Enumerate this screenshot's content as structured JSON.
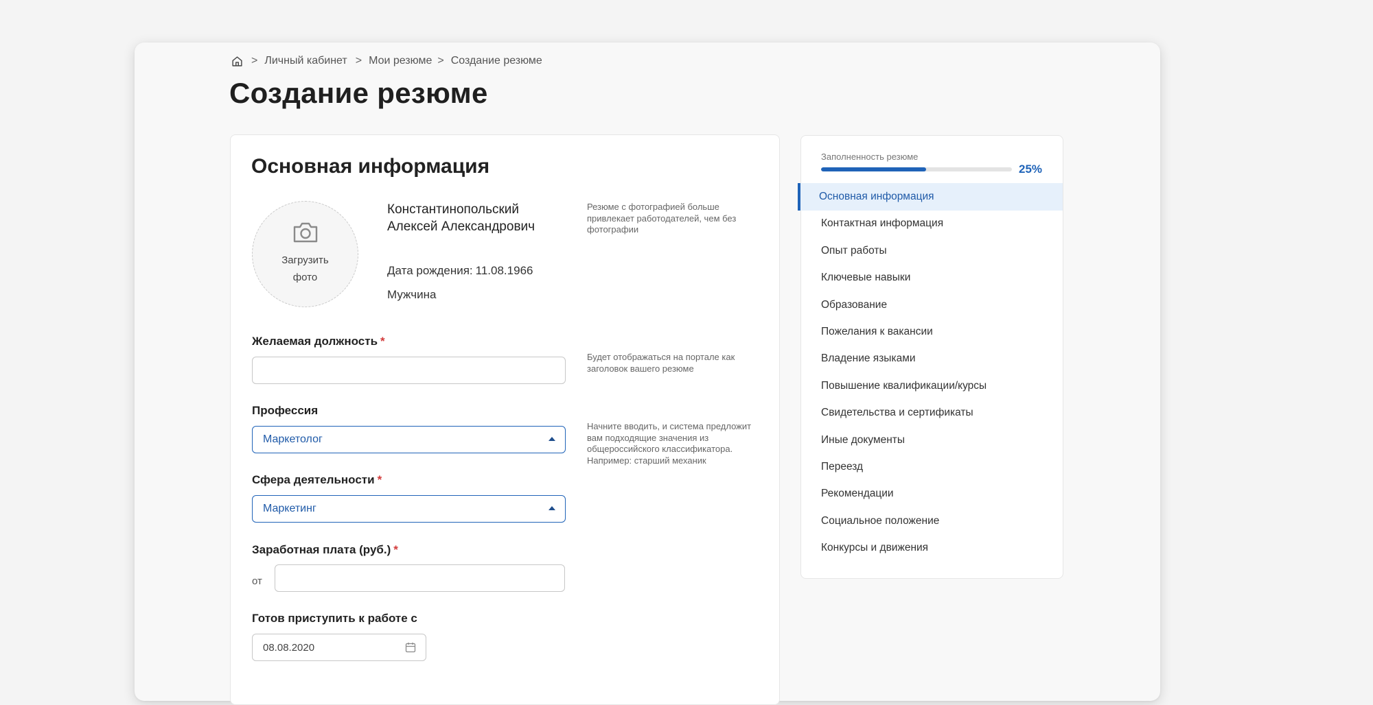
{
  "breadcrumb": {
    "items": [
      "Личный кабинет",
      "Мои резюме",
      "Создание резюме"
    ],
    "separator": ">"
  },
  "page": {
    "title": "Создание резюме"
  },
  "main": {
    "section_title": "Основная информация",
    "photo": {
      "label": "Загрузить фото",
      "icon": "camera-icon"
    },
    "person": {
      "name": "Константинопольский Алексей Александрович",
      "dob_label": "Дата рождения:",
      "dob_value": "11.08.1966",
      "gender": "Мужчина"
    },
    "hints": {
      "photo": "Резюме с фотографией больше привлекает работодателей, чем без фотографии",
      "position": "Будет отображаться на портале как заголовок вашего резюме",
      "profession": "Начните вводить, и система предложит вам подходящие значения из общероссийского классификатора. Например: старший механик"
    },
    "fields": {
      "position": {
        "label": "Желаемая должность",
        "required": "*",
        "value": ""
      },
      "profession": {
        "label": "Профессия",
        "value": "Маркетолог"
      },
      "sphere": {
        "label": "Сфера деятельности",
        "required": "*",
        "value": "Маркетинг"
      },
      "salary": {
        "label": "Заработная плата (руб.)",
        "required": "*",
        "from_label": "от",
        "value": ""
      },
      "start_date": {
        "label": "Готов приступить к работе с",
        "value": "08.08.2020"
      }
    }
  },
  "sidebar": {
    "progress_label": "Заполненность резюме",
    "progress_value": 25,
    "progress_text": "25%",
    "active_index": 0,
    "items": [
      "Основная информация",
      "Контактная информация",
      "Опыт работы",
      "Ключевые навыки",
      "Образование",
      "Пожелания к вакансии",
      "Владение языками",
      "Повышение квалификации/курсы",
      "Свидетельства и сертификаты",
      "Иные документы",
      "Переезд",
      "Рекомендации",
      "Социальное положение",
      "Конкурсы и движения"
    ]
  },
  "colors": {
    "accent": "#1f63b8",
    "required": "#d23b3b",
    "active_bg": "#e6f0fb"
  }
}
